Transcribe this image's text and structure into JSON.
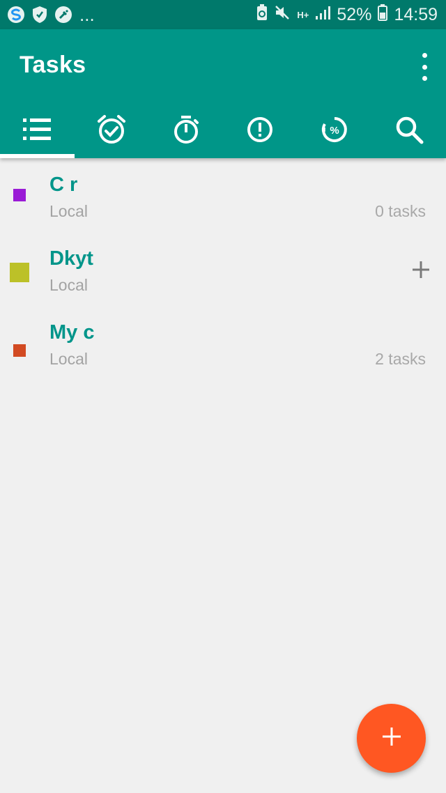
{
  "status_bar": {
    "overflow_indicator": "...",
    "battery_percent": "52%",
    "network_type": "H+",
    "time": "14:59",
    "icons": [
      "s-app-icon",
      "shield-icon",
      "broom-icon",
      "battery-saver-icon",
      "mute-icon",
      "signal-icon",
      "battery-icon"
    ]
  },
  "app_bar": {
    "title": "Tasks",
    "menu_icon": "more-vert-icon",
    "tabs": [
      {
        "icon": "list-icon",
        "active": true
      },
      {
        "icon": "alarm-check-icon",
        "active": false
      },
      {
        "icon": "stopwatch-icon",
        "active": false
      },
      {
        "icon": "priority-icon",
        "active": false
      },
      {
        "icon": "progress-percent-icon",
        "active": false
      },
      {
        "icon": "search-icon",
        "active": false
      }
    ]
  },
  "lists": [
    {
      "name": "C r",
      "account": "Local",
      "count": "0 tasks",
      "color": "#9a1bd6"
    },
    {
      "name": "Dkyt",
      "account": "Local",
      "count": "",
      "color": "#bcc128"
    },
    {
      "name": "My c",
      "account": "Local",
      "count": "2 tasks",
      "color": "#d24a22"
    }
  ],
  "colors": {
    "status_bar": "#00796b",
    "app_bar": "#009688",
    "accent_text": "#00958a",
    "fab": "#ff5722",
    "background": "#f0f0f0"
  },
  "fab": {
    "icon": "plus-icon"
  }
}
